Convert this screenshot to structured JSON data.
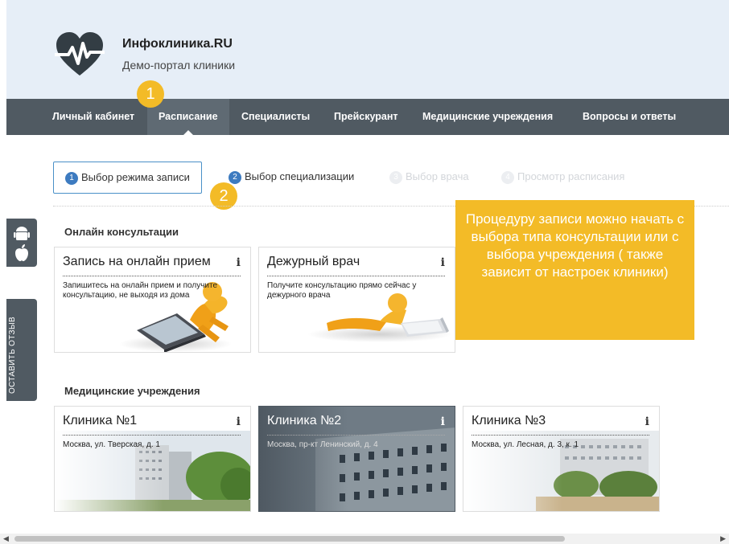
{
  "brand": {
    "title": "Инфоклиника.RU",
    "subtitle": "Демо-портал клиники",
    "logo_icon": "heart-pulse-icon",
    "logo_color": "#333d44"
  },
  "nav": {
    "items": [
      {
        "label": "Личный кабинет",
        "active": false
      },
      {
        "label": "Расписание",
        "active": true
      },
      {
        "label": "Специалисты",
        "active": false
      },
      {
        "label": "Прейскурант",
        "active": false
      },
      {
        "label": "Медицинские учреждения",
        "active": false
      },
      {
        "label": "Вопросы и ответы",
        "active": false
      }
    ],
    "bg_color": "#505a62"
  },
  "callouts": {
    "one": "1",
    "two": "2",
    "color": "#f3bb27"
  },
  "steps": [
    {
      "num": "1",
      "label": "Выбор режима записи",
      "state": "current"
    },
    {
      "num": "2",
      "label": "Выбор специализации",
      "state": "active"
    },
    {
      "num": "3",
      "label": "Выбор врача",
      "state": "inactive"
    },
    {
      "num": "4",
      "label": "Просмотр расписания",
      "state": "inactive"
    }
  ],
  "online": {
    "title": "Онлайн консультации",
    "cards": [
      {
        "title": "Запись на онлайн прием",
        "info": "i",
        "desc": "Запишитесь на онлайн прием и получите консультацию, не выходя из дома"
      },
      {
        "title": "Дежурный врач",
        "info": "i",
        "desc": "Получите консультацию прямо сейчас у дежурного врача"
      }
    ]
  },
  "clinics": {
    "title": "Медицинские учреждения",
    "cards": [
      {
        "title": "Клиника №1",
        "info": "i",
        "desc": "Москва, ул. Тверская, д. 1"
      },
      {
        "title": "Клиника №2",
        "info": "i",
        "desc": "Москва, пр-кт Ленинский, д. 4"
      },
      {
        "title": "Клиника №3",
        "info": "i",
        "desc": "Москва, ул. Лесная, д. 3, к. 1"
      }
    ]
  },
  "sidebar": {
    "feedback_label": "ОСТАВИТЬ ОТЗЫВ",
    "android_icon": "android-icon",
    "apple_icon": "apple-icon"
  },
  "tooltip": {
    "text": "Процедуру записи можно начать с выбора типа консультации или с выбора учреждения ( также зависит от настроек клиники)"
  },
  "scrollbar": {
    "left_arrow": "◀",
    "right_arrow": "▶"
  }
}
